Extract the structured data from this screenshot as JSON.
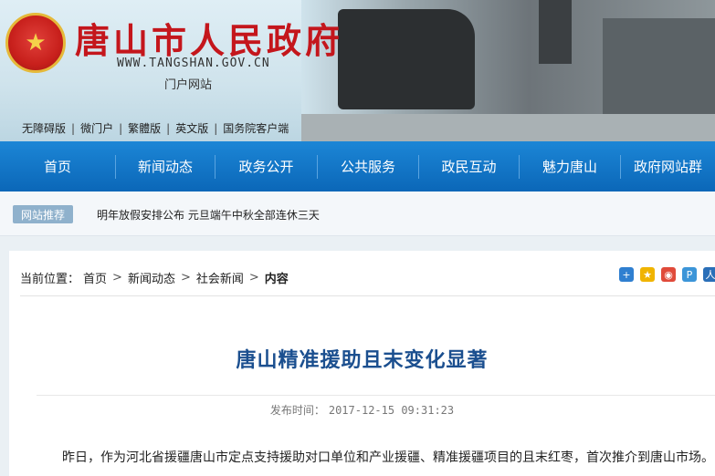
{
  "header": {
    "title": "唐山市人民政府",
    "url": "WWW.TANGSHAN.GOV.CN",
    "subtitle": "门户网站",
    "emblem_icon": "national-emblem",
    "toplinks": [
      "无障碍版",
      "微门户",
      "繁體版",
      "英文版",
      "国务院客户端"
    ]
  },
  "nav": {
    "items": [
      "首页",
      "新闻动态",
      "政务公开",
      "公共服务",
      "政民互动",
      "魅力唐山",
      "政府网站群"
    ]
  },
  "recommend": {
    "badge": "网站推荐",
    "text": "明年放假安排公布 元旦端午中秋全部连休三天"
  },
  "breadcrumb": {
    "label": "当前位置：",
    "items": [
      "首页",
      "新闻动态",
      "社会新闻"
    ],
    "current": "内容"
  },
  "share_icons": [
    "plus-share-icon",
    "qzone-icon",
    "weibo-icon",
    "tencent-weibo-icon",
    "renren-icon"
  ],
  "article": {
    "title": "唐山精准援助且末变化显著",
    "date_label": "发布时间：",
    "date": "2017-12-15 09:31:23",
    "body": "昨日，作为河北省援疆唐山市定点支持援助对口单位和产业援疆、精准援疆项目的且末红枣，首次推介到唐山市场。"
  },
  "colors": {
    "nav_blue": "#0b67b8",
    "title_red": "#c4161c",
    "article_title_blue": "#1b4f8f"
  }
}
